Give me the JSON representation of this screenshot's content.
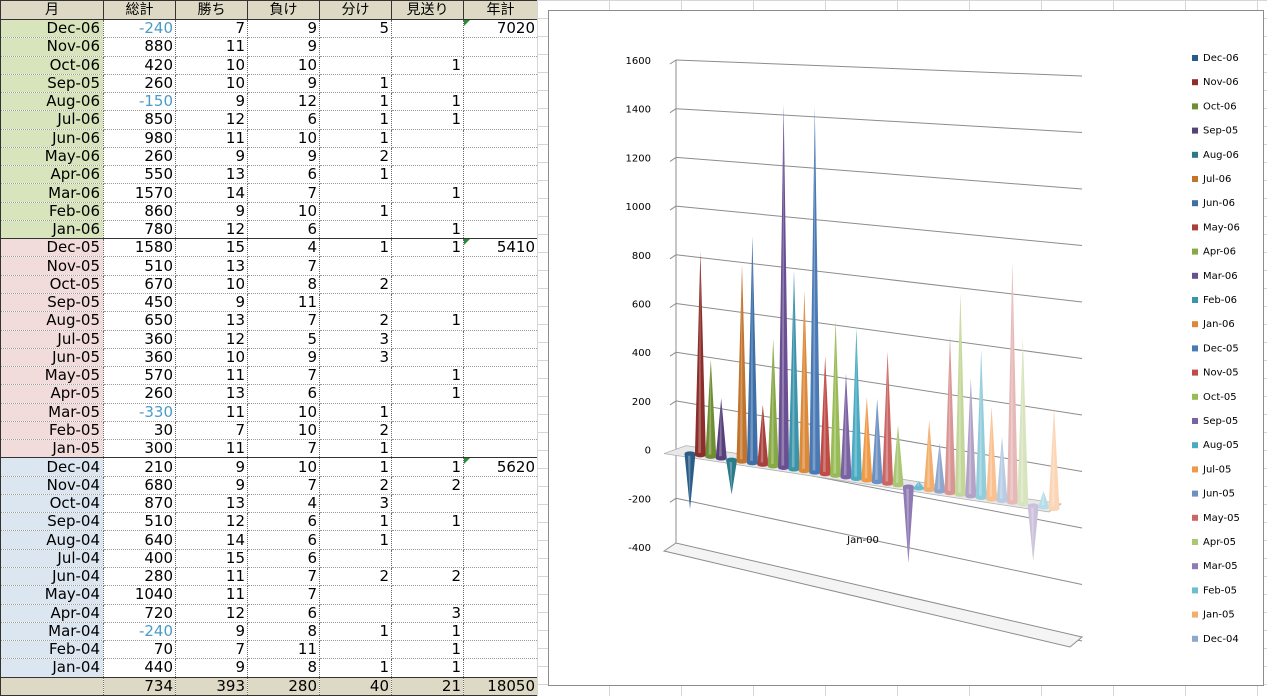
{
  "sheet": {
    "headers": [
      "月",
      "総計",
      "勝ち",
      "負け",
      "分け",
      "見送り",
      "年計"
    ],
    "rows": [
      {
        "month": "Dec-06",
        "total": "-240",
        "win": "7",
        "lose": "9",
        "draw": "5",
        "skip": "",
        "year": "7020",
        "group": "2006"
      },
      {
        "month": "Nov-06",
        "total": "880",
        "win": "11",
        "lose": "9",
        "draw": "",
        "skip": "",
        "year": "",
        "group": "2006"
      },
      {
        "month": "Oct-06",
        "total": "420",
        "win": "10",
        "lose": "10",
        "draw": "",
        "skip": "1",
        "year": "",
        "group": "2006"
      },
      {
        "month": "Sep-05",
        "total": "260",
        "win": "10",
        "lose": "9",
        "draw": "1",
        "skip": "",
        "year": "",
        "group": "2006"
      },
      {
        "month": "Aug-06",
        "total": "-150",
        "win": "9",
        "lose": "12",
        "draw": "1",
        "skip": "1",
        "year": "",
        "group": "2006"
      },
      {
        "month": "Jul-06",
        "total": "850",
        "win": "12",
        "lose": "6",
        "draw": "1",
        "skip": "1",
        "year": "",
        "group": "2006"
      },
      {
        "month": "Jun-06",
        "total": "980",
        "win": "11",
        "lose": "10",
        "draw": "1",
        "skip": "",
        "year": "",
        "group": "2006"
      },
      {
        "month": "May-06",
        "total": "260",
        "win": "9",
        "lose": "9",
        "draw": "2",
        "skip": "",
        "year": "",
        "group": "2006"
      },
      {
        "month": "Apr-06",
        "total": "550",
        "win": "13",
        "lose": "6",
        "draw": "1",
        "skip": "",
        "year": "",
        "group": "2006"
      },
      {
        "month": "Mar-06",
        "total": "1570",
        "win": "14",
        "lose": "7",
        "draw": "",
        "skip": "1",
        "year": "",
        "group": "2006"
      },
      {
        "month": "Feb-06",
        "total": "860",
        "win": "9",
        "lose": "10",
        "draw": "1",
        "skip": "",
        "year": "",
        "group": "2006"
      },
      {
        "month": "Jan-06",
        "total": "780",
        "win": "12",
        "lose": "6",
        "draw": "",
        "skip": "1",
        "year": "",
        "group": "2006"
      },
      {
        "month": "Dec-05",
        "total": "1580",
        "win": "15",
        "lose": "4",
        "draw": "1",
        "skip": "1",
        "year": "5410",
        "group": "2005"
      },
      {
        "month": "Nov-05",
        "total": "510",
        "win": "13",
        "lose": "7",
        "draw": "",
        "skip": "",
        "year": "",
        "group": "2005"
      },
      {
        "month": "Oct-05",
        "total": "670",
        "win": "10",
        "lose": "8",
        "draw": "2",
        "skip": "",
        "year": "",
        "group": "2005"
      },
      {
        "month": "Sep-05",
        "total": "450",
        "win": "9",
        "lose": "11",
        "draw": "",
        "skip": "",
        "year": "",
        "group": "2005"
      },
      {
        "month": "Aug-05",
        "total": "650",
        "win": "13",
        "lose": "7",
        "draw": "2",
        "skip": "1",
        "year": "",
        "group": "2005"
      },
      {
        "month": "Jul-05",
        "total": "360",
        "win": "12",
        "lose": "5",
        "draw": "3",
        "skip": "",
        "year": "",
        "group": "2005"
      },
      {
        "month": "Jun-05",
        "total": "360",
        "win": "10",
        "lose": "9",
        "draw": "3",
        "skip": "",
        "year": "",
        "group": "2005"
      },
      {
        "month": "May-05",
        "total": "570",
        "win": "11",
        "lose": "7",
        "draw": "",
        "skip": "1",
        "year": "",
        "group": "2005"
      },
      {
        "month": "Apr-05",
        "total": "260",
        "win": "13",
        "lose": "6",
        "draw": "",
        "skip": "1",
        "year": "",
        "group": "2005"
      },
      {
        "month": "Mar-05",
        "total": "-330",
        "win": "11",
        "lose": "10",
        "draw": "1",
        "skip": "",
        "year": "",
        "group": "2005"
      },
      {
        "month": "Feb-05",
        "total": "30",
        "win": "7",
        "lose": "10",
        "draw": "2",
        "skip": "",
        "year": "",
        "group": "2005"
      },
      {
        "month": "Jan-05",
        "total": "300",
        "win": "11",
        "lose": "7",
        "draw": "1",
        "skip": "",
        "year": "",
        "group": "2005"
      },
      {
        "month": "Dec-04",
        "total": "210",
        "win": "9",
        "lose": "10",
        "draw": "1",
        "skip": "1",
        "year": "5620",
        "group": "2004"
      },
      {
        "month": "Nov-04",
        "total": "680",
        "win": "9",
        "lose": "7",
        "draw": "2",
        "skip": "2",
        "year": "",
        "group": "2004"
      },
      {
        "month": "Oct-04",
        "total": "870",
        "win": "13",
        "lose": "4",
        "draw": "3",
        "skip": "",
        "year": "",
        "group": "2004"
      },
      {
        "month": "Sep-04",
        "total": "510",
        "win": "12",
        "lose": "6",
        "draw": "1",
        "skip": "1",
        "year": "",
        "group": "2004"
      },
      {
        "month": "Aug-04",
        "total": "640",
        "win": "14",
        "lose": "6",
        "draw": "1",
        "skip": "",
        "year": "",
        "group": "2004"
      },
      {
        "month": "Jul-04",
        "total": "400",
        "win": "15",
        "lose": "6",
        "draw": "",
        "skip": "",
        "year": "",
        "group": "2004"
      },
      {
        "month": "Jun-04",
        "total": "280",
        "win": "11",
        "lose": "7",
        "draw": "2",
        "skip": "2",
        "year": "",
        "group": "2004"
      },
      {
        "month": "May-04",
        "total": "1040",
        "win": "11",
        "lose": "7",
        "draw": "",
        "skip": "",
        "year": "",
        "group": "2004"
      },
      {
        "month": "Apr-04",
        "total": "720",
        "win": "12",
        "lose": "6",
        "draw": "",
        "skip": "3",
        "year": "",
        "group": "2004"
      },
      {
        "month": "Mar-04",
        "total": "-240",
        "win": "9",
        "lose": "8",
        "draw": "1",
        "skip": "1",
        "year": "",
        "group": "2004"
      },
      {
        "month": "Feb-04",
        "total": "70",
        "win": "7",
        "lose": "11",
        "draw": "",
        "skip": "1",
        "year": "",
        "group": "2004"
      },
      {
        "month": "Jan-04",
        "total": "440",
        "win": "9",
        "lose": "8",
        "draw": "1",
        "skip": "1",
        "year": "",
        "group": "2004"
      }
    ],
    "totals": {
      "month": "",
      "total": "734",
      "win": "393",
      "lose": "280",
      "draw": "40",
      "skip": "21",
      "year": "18050"
    }
  },
  "chart_data": {
    "type": "bar",
    "style": "3d-cone",
    "categories": [
      "Jan-00"
    ],
    "xlabel": "",
    "ylabel": "",
    "ylim": [
      -400,
      1600
    ],
    "yticks": [
      -400,
      -200,
      0,
      200,
      400,
      600,
      800,
      1000,
      1200,
      1400,
      1600
    ],
    "grid": true,
    "legend_position": "right",
    "series": [
      {
        "name": "Dec-06",
        "value": -240,
        "color": "#2a5c88"
      },
      {
        "name": "Nov-06",
        "value": 880,
        "color": "#8c2f2a"
      },
      {
        "name": "Oct-06",
        "value": 420,
        "color": "#6f8e33"
      },
      {
        "name": "Sep-05",
        "value": 260,
        "color": "#58407a"
      },
      {
        "name": "Aug-06",
        "value": -150,
        "color": "#2a7a8a"
      },
      {
        "name": "Jul-06",
        "value": 850,
        "color": "#c2742c"
      },
      {
        "name": "Jun-06",
        "value": 980,
        "color": "#3e6fa8"
      },
      {
        "name": "May-06",
        "value": 260,
        "color": "#a8403c"
      },
      {
        "name": "Apr-06",
        "value": 550,
        "color": "#86a845"
      },
      {
        "name": "Mar-06",
        "value": 1570,
        "color": "#6a4f93"
      },
      {
        "name": "Feb-06",
        "value": 860,
        "color": "#3b94aa"
      },
      {
        "name": "Jan-06",
        "value": 780,
        "color": "#dc8a3a"
      },
      {
        "name": "Dec-05",
        "value": 1580,
        "color": "#4a7ab5"
      },
      {
        "name": "Nov-05",
        "value": 510,
        "color": "#bf4c47"
      },
      {
        "name": "Oct-05",
        "value": 670,
        "color": "#98bb55"
      },
      {
        "name": "Sep-05",
        "value": 450,
        "color": "#7b62a3"
      },
      {
        "name": "Aug-05",
        "value": 650,
        "color": "#4cabc2"
      },
      {
        "name": "Jul-05",
        "value": 360,
        "color": "#ef9a48"
      },
      {
        "name": "Jun-05",
        "value": 360,
        "color": "#6c90c2"
      },
      {
        "name": "May-05",
        "value": 570,
        "color": "#cc6664"
      },
      {
        "name": "Apr-05",
        "value": 260,
        "color": "#a9c873"
      },
      {
        "name": "Mar-05",
        "value": -330,
        "color": "#8f7ab4"
      },
      {
        "name": "Feb-05",
        "value": 30,
        "color": "#6dbdd0"
      },
      {
        "name": "Jan-05",
        "value": 300,
        "color": "#f3ae6c"
      },
      {
        "name": "Dec-04",
        "value": 210,
        "color": "#8fa7cf"
      }
    ],
    "extra_cones": [
      {
        "value": 680,
        "color": "#d99593"
      },
      {
        "value": 870,
        "color": "#c4d79b"
      },
      {
        "value": 510,
        "color": "#b3a2c7"
      },
      {
        "value": 640,
        "color": "#92cddc"
      },
      {
        "value": 400,
        "color": "#fac090"
      },
      {
        "value": 280,
        "color": "#b8cce4"
      },
      {
        "value": 1040,
        "color": "#e6b9b8"
      },
      {
        "value": 720,
        "color": "#d7e4bd"
      },
      {
        "value": -240,
        "color": "#ccc1da"
      },
      {
        "value": 70,
        "color": "#b7dee8"
      },
      {
        "value": 440,
        "color": "#fcd5b5"
      }
    ]
  }
}
